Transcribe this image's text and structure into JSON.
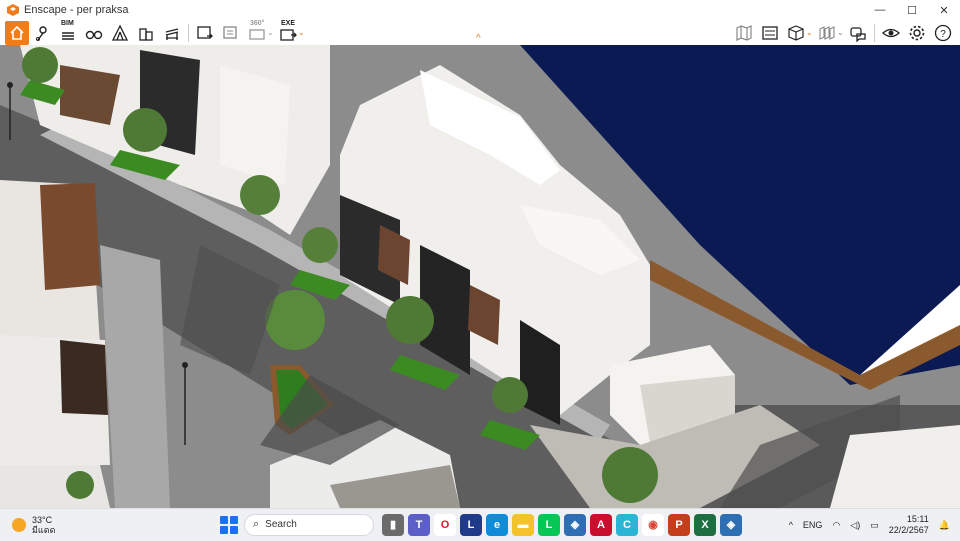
{
  "window": {
    "title": "Enscape - per praksa",
    "controls": {
      "minimize": "—",
      "maximize": "☐",
      "close": "✕"
    }
  },
  "toolbar": {
    "left_buttons": [
      {
        "name": "home-icon",
        "active": true
      },
      {
        "name": "map-pin-icon"
      },
      {
        "name": "bim-icon",
        "label": "BIM"
      },
      {
        "name": "binoculars-icon"
      },
      {
        "name": "tent-icon"
      },
      {
        "name": "building-icon"
      },
      {
        "name": "bench-icon"
      },
      {
        "name": "render-screenshot-icon"
      },
      {
        "name": "batch-render-icon"
      },
      {
        "name": "panorama-icon",
        "label": "360°"
      },
      {
        "name": "export-exe-icon",
        "label": "EXE"
      }
    ],
    "right_buttons": [
      {
        "name": "map-icon"
      },
      {
        "name": "video-editor-icon"
      },
      {
        "name": "cube-view-icon"
      },
      {
        "name": "views-icon"
      },
      {
        "name": "collaborate-icon"
      },
      {
        "name": "visibility-icon"
      },
      {
        "name": "settings-gear-icon"
      },
      {
        "name": "help-icon"
      }
    ],
    "collapse_glyph": "^"
  },
  "taskbar": {
    "weather_temp": "33°C",
    "weather_desc": "มีแดด",
    "search_placeholder": "Search",
    "apps": [
      {
        "name": "file-explorer-icon",
        "bg": "#6b6b6b",
        "glyph": "▮"
      },
      {
        "name": "teams-icon",
        "bg": "#5b5fc7",
        "glyph": "T"
      },
      {
        "name": "opera-icon",
        "bg": "#ffffff",
        "glyph": "O",
        "fg": "#e0142b"
      },
      {
        "name": "app-l-icon",
        "bg": "#1f3b8a",
        "glyph": "L"
      },
      {
        "name": "edge-icon",
        "bg": "#0f8bd8",
        "glyph": "e"
      },
      {
        "name": "folder-icon",
        "bg": "#f4c22b",
        "glyph": "▬"
      },
      {
        "name": "line-icon",
        "bg": "#06c755",
        "glyph": "L"
      },
      {
        "name": "enscape-icon-1",
        "bg": "#2e6fb3",
        "glyph": "◈"
      },
      {
        "name": "autocad-icon",
        "bg": "#c8102e",
        "glyph": "A"
      },
      {
        "name": "canva-icon",
        "bg": "#2bb5d4",
        "glyph": "C"
      },
      {
        "name": "chrome-icon",
        "bg": "#ffffff",
        "glyph": "◉",
        "fg": "#db4437"
      },
      {
        "name": "powerpoint-icon",
        "bg": "#c43e1c",
        "glyph": "P"
      },
      {
        "name": "excel-icon",
        "bg": "#1d6f42",
        "glyph": "X"
      },
      {
        "name": "enscape-icon-2",
        "bg": "#2e6fb3",
        "glyph": "◈"
      }
    ],
    "tray": {
      "chevron": "^",
      "language": "ENG",
      "wifi": "wifi-icon",
      "volume": "volume-icon",
      "battery": "battery-icon"
    },
    "time": "15:11",
    "date": "22/2/2567"
  }
}
